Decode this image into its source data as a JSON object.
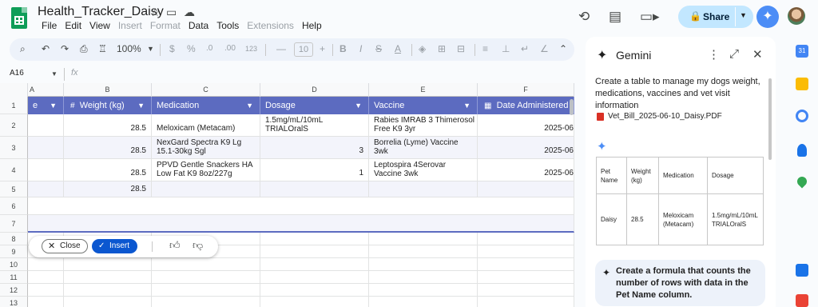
{
  "doc": {
    "title": "Health_Tracker_Daisy"
  },
  "menu": [
    "File",
    "Edit",
    "View",
    "Insert",
    "Format",
    "Data",
    "Tools",
    "Extensions",
    "Help"
  ],
  "menu_disabled": [
    "Insert",
    "Format",
    "Extensions"
  ],
  "share": {
    "label": "Share"
  },
  "toolbar": {
    "zoom": "100%",
    "currency": "$",
    "percent": "%",
    "dec_dec": ".0",
    "dec_inc": ".00",
    "number_format": "123",
    "font_minus": "—",
    "font_size": "10",
    "font_plus": "+"
  },
  "formula_bar": {
    "cell_ref": "A16",
    "fx": "fx"
  },
  "sheet": {
    "columns": [
      "A",
      "B",
      "C",
      "D",
      "E",
      "F"
    ],
    "rows": [
      "1",
      "2",
      "3",
      "4",
      "5",
      "6",
      "7",
      "8",
      "9",
      "10",
      "11",
      "12",
      "13"
    ],
    "headers": {
      "pet_tail": "e",
      "weight": "Weight (kg)",
      "medication": "Medication",
      "dosage": "Dosage",
      "vaccine": "Vaccine",
      "date": "Date Administered"
    },
    "data": [
      {
        "weight": "28.5",
        "medication_1": "Meloxicam (Metacam)",
        "medication_2": "",
        "dosage_1": "1.5mg/mL/10mL",
        "dosage_2": "TRIALOralS",
        "vaccine_1": "Rabies IMRAB 3 Thimerosol",
        "vaccine_2": "Free K9 3yr",
        "date": "2025-06"
      },
      {
        "weight": "28.5",
        "medication_1": "NexGard Spectra K9 Lg",
        "medication_2": "15.1-30kg Sgl",
        "dosage_1": "3",
        "dosage_2": "",
        "vaccine_1": "Borrelia (Lyme) Vaccine",
        "vaccine_2": "3wk",
        "date": "2025-06"
      },
      {
        "weight": "28.5",
        "medication_1": "PPVD Gentle Snackers HA",
        "medication_2": "Low Fat K9 8oz/227g",
        "dosage_1": "1",
        "dosage_2": "",
        "vaccine_1": "Leptospira 4Serovar",
        "vaccine_2": "Vaccine 3wk",
        "date": "2025-06"
      },
      {
        "weight": "28.5",
        "medication_1": "",
        "medication_2": "",
        "dosage_1": "",
        "dosage_2": "",
        "vaccine_1": "",
        "vaccine_2": "",
        "date": ""
      }
    ]
  },
  "floatbar": {
    "close_label": "Close",
    "insert_label": "Insert"
  },
  "gemini": {
    "title": "Gemini",
    "prompt": "Create a table to manage my dogs weight, medications, vaccines and vet visit information",
    "attachment": "Vet_Bill_2025-06-10_Daisy.PDF",
    "table": {
      "headers": [
        "Pet Name",
        "Weight (kg)",
        "Medication",
        "Dosage"
      ],
      "row": [
        "Daisy",
        "28.5",
        "Meloxicam (Metacam)",
        "1.5mg/mL/10mL TRIALOralS"
      ]
    },
    "suggestion": "Create a formula that counts the number of rows with data in the Pet Name column."
  },
  "colors": {
    "header_bg": "#5c6bc0",
    "accent": "#0b57d0",
    "share_bg": "#c2e7ff"
  }
}
